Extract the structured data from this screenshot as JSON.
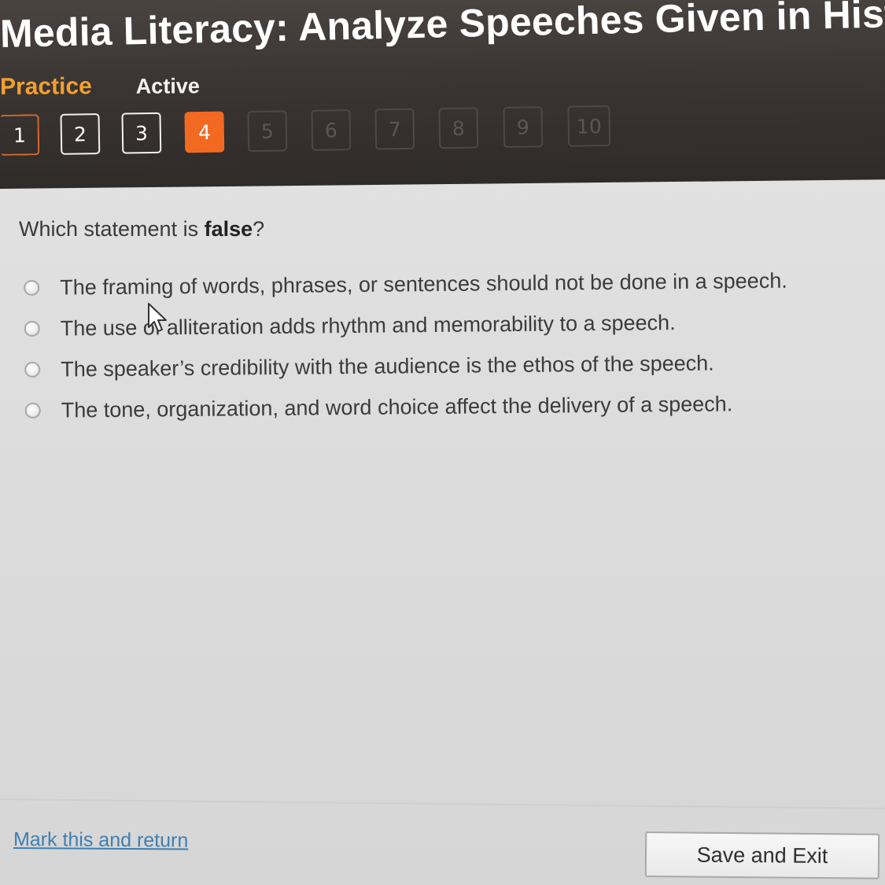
{
  "header": {
    "title": "Media Literacy: Analyze Speeches Given in Histor",
    "tabs": [
      {
        "label": "Practice",
        "state": "selected"
      },
      {
        "label": "Active",
        "state": "normal"
      }
    ]
  },
  "question_nav": {
    "current": "4",
    "items": [
      {
        "label": "1",
        "state": "answered"
      },
      {
        "label": "2",
        "state": "answered"
      },
      {
        "label": "3",
        "state": "answered"
      },
      {
        "label": "4",
        "state": "current"
      },
      {
        "label": "5",
        "state": "locked"
      },
      {
        "label": "6",
        "state": "locked"
      },
      {
        "label": "7",
        "state": "locked"
      },
      {
        "label": "8",
        "state": "locked"
      },
      {
        "label": "9",
        "state": "locked"
      },
      {
        "label": "10",
        "state": "locked"
      }
    ]
  },
  "question": {
    "prefix": "Which statement is ",
    "emphasis": "false",
    "suffix": "?"
  },
  "options": [
    {
      "text": "The framing of words, phrases, or sentences should not be done in a speech.",
      "selected": false
    },
    {
      "text": "The use of alliteration adds rhythm and memorability to a speech.",
      "selected": false
    },
    {
      "text": "The speaker’s credibility with the audience is the ethos of the speech.",
      "selected": false
    },
    {
      "text": "The tone, organization, and word choice affect the delivery of a speech.",
      "selected": false
    }
  ],
  "footer": {
    "mark_label": "Mark this and return",
    "save_label": "Save and Exit"
  },
  "colors": {
    "header_bg": "#3a3533",
    "accent_orange": "#f26a22",
    "practice_tab": "#f3a02e",
    "link_blue": "#3f7fb0"
  },
  "icons": {
    "cursor": "mouse-pointer-icon",
    "radio": "radio-button"
  }
}
